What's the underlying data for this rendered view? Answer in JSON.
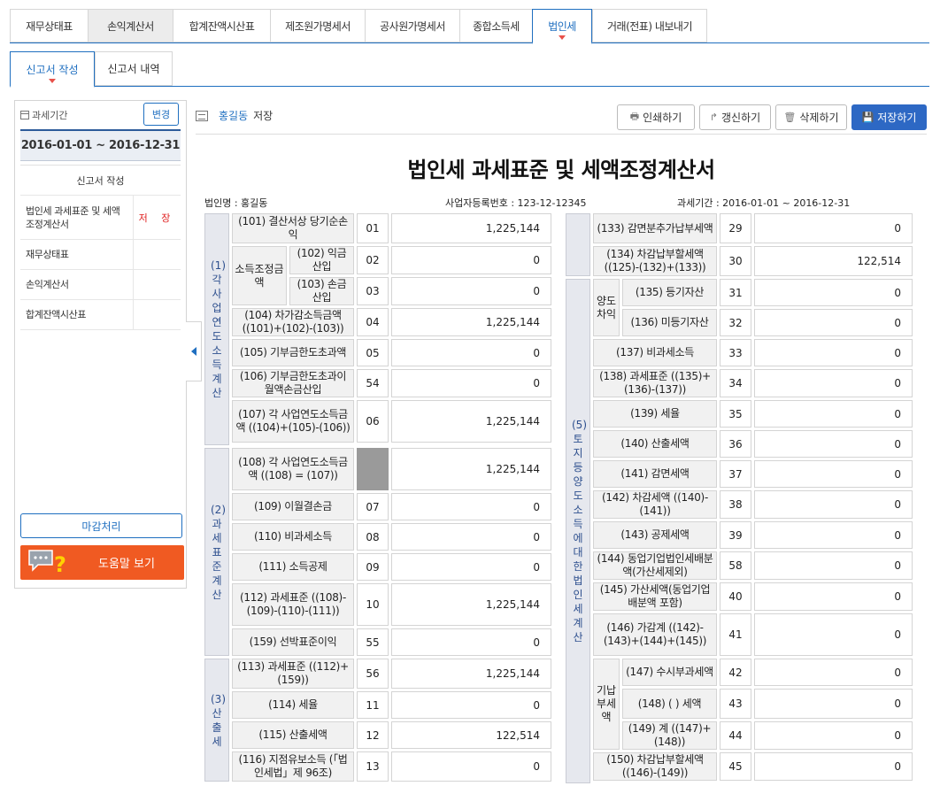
{
  "topnav": {
    "tabs": [
      "재무상태표",
      "손익계산서",
      "합계잔액시산표",
      "제조원가명세서",
      "공사원가명세서",
      "종합소득세",
      "법인세",
      "거래(전표) 내보내기"
    ]
  },
  "subnav": {
    "tabs": [
      "신고서 작성",
      "신고서 내역"
    ]
  },
  "left": {
    "period_label": "과세기간",
    "change_button": "변경",
    "period": "2016-01-01 ~ 2016-12-31",
    "forms_header": "신고서 작성",
    "forms": [
      {
        "name": "법인세 과세표준 및 세액조정계산서",
        "status": "저 장"
      },
      {
        "name": "재무상태표",
        "status": ""
      },
      {
        "name": "손익계산서",
        "status": ""
      },
      {
        "name": "합계잔액시산표",
        "status": ""
      }
    ],
    "close_button": "마감처리",
    "help_button": "도움말 보기"
  },
  "header": {
    "user": "홍길동",
    "status": "저장",
    "buttons": {
      "print": "인쇄하기",
      "refresh": "갱신하기",
      "delete": "삭제하기",
      "save": "저장하기"
    }
  },
  "doc": {
    "title": "법인세 과세표준 및 세액조정계산서",
    "corp_name": "법인명 : 홍길동",
    "biz_no": "사업자등록번호 : 123-12-12345",
    "period": "과세기간 : 2016-01-01 ~ 2016-12-31"
  },
  "sections": {
    "s1": "(1)각사업연도소득계산",
    "s2": "(2)과세표준계산",
    "s3": "(3)산출세",
    "s5": "(5)토지등양도소득에대한법인세계산"
  },
  "left_table": {
    "r101": {
      "label": "(101) 결산서상 당기순손익",
      "code": "01",
      "value": "1,225,144"
    },
    "group_102": "소득조정금액",
    "r102": {
      "label": "(102) 익금산입",
      "code": "02",
      "value": "0"
    },
    "r103": {
      "label": "(103) 손금산입",
      "code": "03",
      "value": "0"
    },
    "r104": {
      "label": "(104) 차가감소득금액 ((101)+(102)-(103))",
      "code": "04",
      "value": "1,225,144"
    },
    "r105": {
      "label": "(105) 기부금한도초과액",
      "code": "05",
      "value": "0"
    },
    "r106": {
      "label": "(106) 기부금한도초과이월액손금산입",
      "code": "54",
      "value": "0"
    },
    "r107": {
      "label": "(107) 각 사업연도소득금액 ((104)+(105)-(106))",
      "code": "06",
      "value": "1,225,144"
    },
    "r108": {
      "label": "(108) 각 사업연도소득금액 ((108) = (107))",
      "value": "1,225,144"
    },
    "r109": {
      "label": "(109) 이월결손금",
      "code": "07",
      "value": "0"
    },
    "r110": {
      "label": "(110) 비과세소득",
      "code": "08",
      "value": "0"
    },
    "r111": {
      "label": "(111) 소득공제",
      "code": "09",
      "value": "0"
    },
    "r112": {
      "label": "(112) 과세표준 ((108)-(109)-(110)-(111))",
      "code": "10",
      "value": "1,225,144"
    },
    "r159": {
      "label": "(159) 선박표준이익",
      "code": "55",
      "value": "0"
    },
    "r113": {
      "label": "(113) 과세표준 ((112)+(159))",
      "code": "56",
      "value": "1,225,144"
    },
    "r114": {
      "label": "(114) 세율",
      "code": "11",
      "value": "0"
    },
    "r115": {
      "label": "(115) 산출세액",
      "code": "12",
      "value": "122,514"
    },
    "r116": {
      "label": "(116) 지점유보소득 (「법인세법」제 96조)",
      "code": "13",
      "value": "0"
    }
  },
  "right_table": {
    "r133": {
      "label": "(133) 감면분추가납부세액",
      "code": "29",
      "value": "0"
    },
    "r134": {
      "label": "(134) 차감납부할세액 ((125)-(132)+(133))",
      "code": "30",
      "value": "122,514"
    },
    "group_135": "양도차익",
    "r135": {
      "label": "(135) 등기자산",
      "code": "31",
      "value": "0"
    },
    "r136": {
      "label": "(136) 미등기자산",
      "code": "32",
      "value": "0"
    },
    "r137": {
      "label": "(137) 비과세소득",
      "code": "33",
      "value": "0"
    },
    "r138": {
      "label": "(138) 과세표준 ((135)+(136)-(137))",
      "code": "34",
      "value": "0"
    },
    "r139": {
      "label": "(139) 세율",
      "code": "35",
      "value": "0"
    },
    "r140": {
      "label": "(140) 산출세액",
      "code": "36",
      "value": "0"
    },
    "r141": {
      "label": "(141) 감면세액",
      "code": "37",
      "value": "0"
    },
    "r142": {
      "label": "(142) 차감세액 ((140)-(141))",
      "code": "38",
      "value": "0"
    },
    "r143": {
      "label": "(143) 공제세액",
      "code": "39",
      "value": "0"
    },
    "r144": {
      "label": "(144) 동업기업법인세배분액(가산세제외)",
      "code": "58",
      "value": "0"
    },
    "r145": {
      "label": "(145) 가산세액(동업기업배분액 포함)",
      "code": "40",
      "value": "0"
    },
    "r146": {
      "label": "(146) 가감계 ((142)-(143)+(144)+(145))",
      "code": "41",
      "value": "0"
    },
    "group_147": "기납부세액",
    "r147": {
      "label": "(147) 수시부과세액",
      "code": "42",
      "value": "0"
    },
    "r148": {
      "label": "(148) (         ) 세액",
      "code": "43",
      "value": "0"
    },
    "r149": {
      "label": "(149) 계 ((147)+(148))",
      "code": "44",
      "value": "0"
    },
    "r150": {
      "label": "(150) 차감납부할세액 ((146)-(149))",
      "code": "45",
      "value": "0"
    }
  }
}
